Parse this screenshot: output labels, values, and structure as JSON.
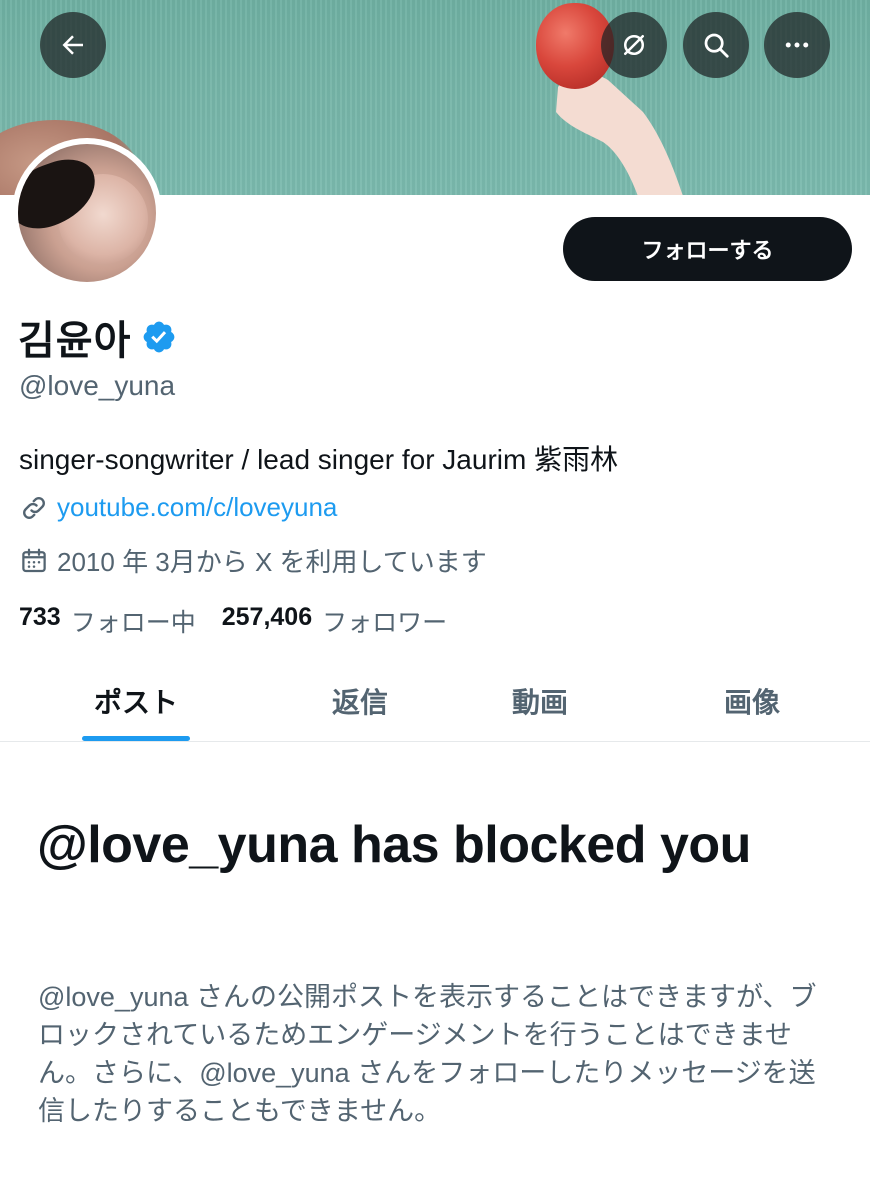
{
  "header": {
    "back_icon": "arrow-left-icon",
    "buttons": [
      {
        "icon": "link-off-icon"
      },
      {
        "icon": "search-icon"
      },
      {
        "icon": "more-horizontal-icon"
      }
    ]
  },
  "profile": {
    "display_name": "김윤아",
    "verified": true,
    "handle": "@love_yuna",
    "bio": "singer-songwriter / lead singer for Jaurim 紫雨林",
    "link": "youtube.com/c/loveyuna",
    "joined": "2010 年 3月から X を利用しています",
    "follow_label": "フォローする",
    "stats": {
      "following_count": "733",
      "following_label": "フォロー中",
      "followers_count": "257,406",
      "followers_label": "フォロワー"
    }
  },
  "tabs": [
    {
      "label": "ポスト",
      "active": true
    },
    {
      "label": "返信",
      "active": false
    },
    {
      "label": "動画",
      "active": false
    },
    {
      "label": "画像",
      "active": false
    }
  ],
  "blocked": {
    "title": "@love_yuna has blocked you",
    "description": "@love_yuna さんの公開ポストを表示することはできますが、ブロックされているためエンゲージメントを行うことはできません。さらに、@love_yuna さんをフォローしたりメッセージを送信したりすることもできません。"
  },
  "colors": {
    "accent": "#1d9bf0",
    "text_primary": "#0f1419",
    "text_secondary": "#536471",
    "button_dark": "#0f1419"
  }
}
